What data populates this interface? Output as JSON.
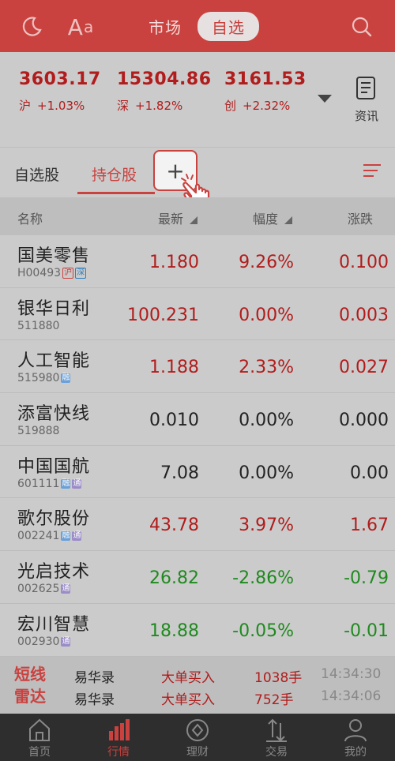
{
  "header": {
    "tab_market": "市场",
    "tab_watchlist": "自选",
    "font_label_big": "A",
    "font_label_small": "a",
    "accent_color": "#c9423f"
  },
  "indices": [
    {
      "value": "3603.17",
      "name": "沪",
      "change": "+1.03%"
    },
    {
      "value": "15304.86",
      "name": "深",
      "change": "+1.82%"
    },
    {
      "value": "3161.53",
      "name": "创",
      "change": "+2.32%"
    }
  ],
  "news_label": "资讯",
  "tabs": {
    "watch_stocks": "自选股",
    "holdings": "持仓股",
    "add": "+"
  },
  "columns": {
    "name": "名称",
    "latest": "最新",
    "amplitude": "幅度",
    "change": "涨跌"
  },
  "rows": [
    {
      "name": "国美零售",
      "code": "H00493",
      "tags": [
        "沪",
        "深"
      ],
      "latest": "1.180",
      "amp": "9.26%",
      "chg": "0.100",
      "trend": "up"
    },
    {
      "name": "银华日利",
      "code": "511880",
      "tags": [],
      "latest": "100.231",
      "amp": "0.00%",
      "chg": "0.003",
      "trend": "up"
    },
    {
      "name": "人工智能",
      "code": "515980",
      "tags": [
        "融"
      ],
      "latest": "1.188",
      "amp": "2.33%",
      "chg": "0.027",
      "trend": "up"
    },
    {
      "name": "添富快线",
      "code": "519888",
      "tags": [],
      "latest": "0.010",
      "amp": "0.00%",
      "chg": "0.000",
      "trend": "flat"
    },
    {
      "name": "中国国航",
      "code": "601111",
      "tags": [
        "融",
        "通"
      ],
      "latest": "7.08",
      "amp": "0.00%",
      "chg": "0.00",
      "trend": "flat"
    },
    {
      "name": "歌尔股份",
      "code": "002241",
      "tags": [
        "融",
        "通"
      ],
      "latest": "43.78",
      "amp": "3.97%",
      "chg": "1.67",
      "trend": "up"
    },
    {
      "name": "光启技术",
      "code": "002625",
      "tags": [
        "通"
      ],
      "latest": "26.82",
      "amp": "-2.86%",
      "chg": "-0.79",
      "trend": "down"
    },
    {
      "name": "宏川智慧",
      "code": "002930",
      "tags": [
        "通"
      ],
      "latest": "18.88",
      "amp": "-0.05%",
      "chg": "-0.01",
      "trend": "down"
    }
  ],
  "ticker": {
    "logo_line1": "短线",
    "logo_line2": "雷达",
    "items": [
      {
        "name": "易华录",
        "action": "大单买入",
        "volume": "1038手",
        "time": "14:34:30"
      },
      {
        "name": "易华录",
        "action": "大单买入",
        "volume": "752手",
        "time": "14:34:06"
      }
    ]
  },
  "nav": [
    {
      "label": "首页",
      "icon": "home-icon"
    },
    {
      "label": "行情",
      "icon": "chart-bar-icon"
    },
    {
      "label": "理财",
      "icon": "diamond-circle-icon"
    },
    {
      "label": "交易",
      "icon": "trade-arrows-icon"
    },
    {
      "label": "我的",
      "icon": "user-icon"
    }
  ]
}
